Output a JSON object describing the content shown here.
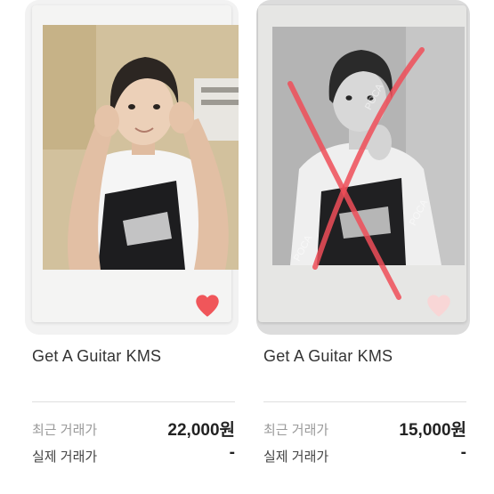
{
  "cards": [
    {
      "title": "Get A Guitar KMS",
      "recent_price_label": "최근 거래가",
      "recent_price": "22,000원",
      "actual_price_label": "실제 거래가",
      "actual_price": "-",
      "heart_color": "#f0565a",
      "favorited": true
    },
    {
      "title": "Get A Guitar KMS",
      "recent_price_label": "최근 거래가",
      "recent_price": "15,000원",
      "actual_price_label": "실제 거래가",
      "actual_price": "-",
      "heart_color": "#f8d6d6",
      "favorited": false,
      "watermark": "POCA",
      "cross_color": "#ee4e58"
    }
  ]
}
